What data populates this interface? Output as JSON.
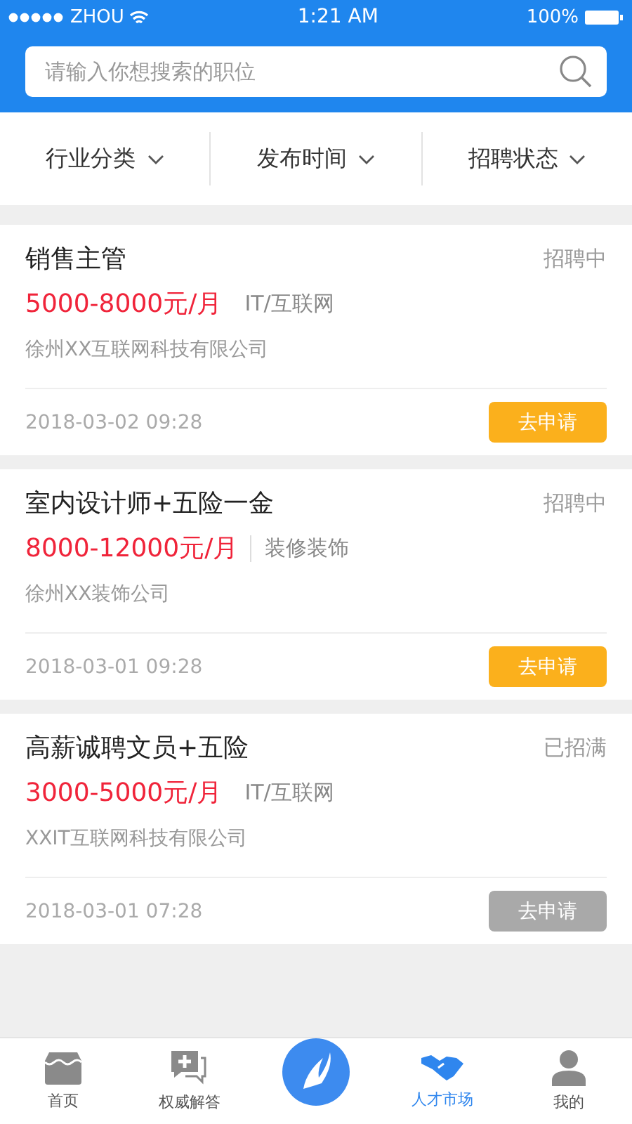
{
  "status_bar": {
    "carrier": "ZHOU",
    "time": "1:21 AM",
    "battery": "100%"
  },
  "search": {
    "placeholder": "请输入你想搜索的职位"
  },
  "filters": [
    {
      "label": "行业分类"
    },
    {
      "label": "发布时间"
    },
    {
      "label": "招聘状态"
    }
  ],
  "jobs": [
    {
      "title": "销售主管",
      "status": "招聘中",
      "salary": "5000-8000元/月",
      "industry": "IT/互联网",
      "divided": false,
      "company": "徐州XX互联网科技有限公司",
      "date": "2018-03-02 09:28",
      "button": "去申请",
      "disabled": false
    },
    {
      "title": "室内设计师+五险一金",
      "status": "招聘中",
      "salary": "8000-12000元/月",
      "industry": "装修装饰",
      "divided": true,
      "company": "徐州XX装饰公司",
      "date": "2018-03-01 09:28",
      "button": "去申请",
      "disabled": false
    },
    {
      "title": "高薪诚聘文员+五险",
      "status": "已招满",
      "salary": "3000-5000元/月",
      "industry": "IT/互联网",
      "divided": false,
      "company": "XXIT互联网科技有限公司",
      "date": "2018-03-01 07:28",
      "button": "去申请",
      "disabled": true
    }
  ],
  "tab_bar": [
    {
      "kind": "home",
      "label": "首页",
      "selected": false
    },
    {
      "kind": "chat",
      "label": "权威解答",
      "selected": false
    },
    {
      "kind": "logo",
      "selected": false
    },
    {
      "kind": "handshake",
      "label": "人才市场",
      "selected": true
    },
    {
      "kind": "person",
      "label": "我的",
      "selected": false
    }
  ]
}
